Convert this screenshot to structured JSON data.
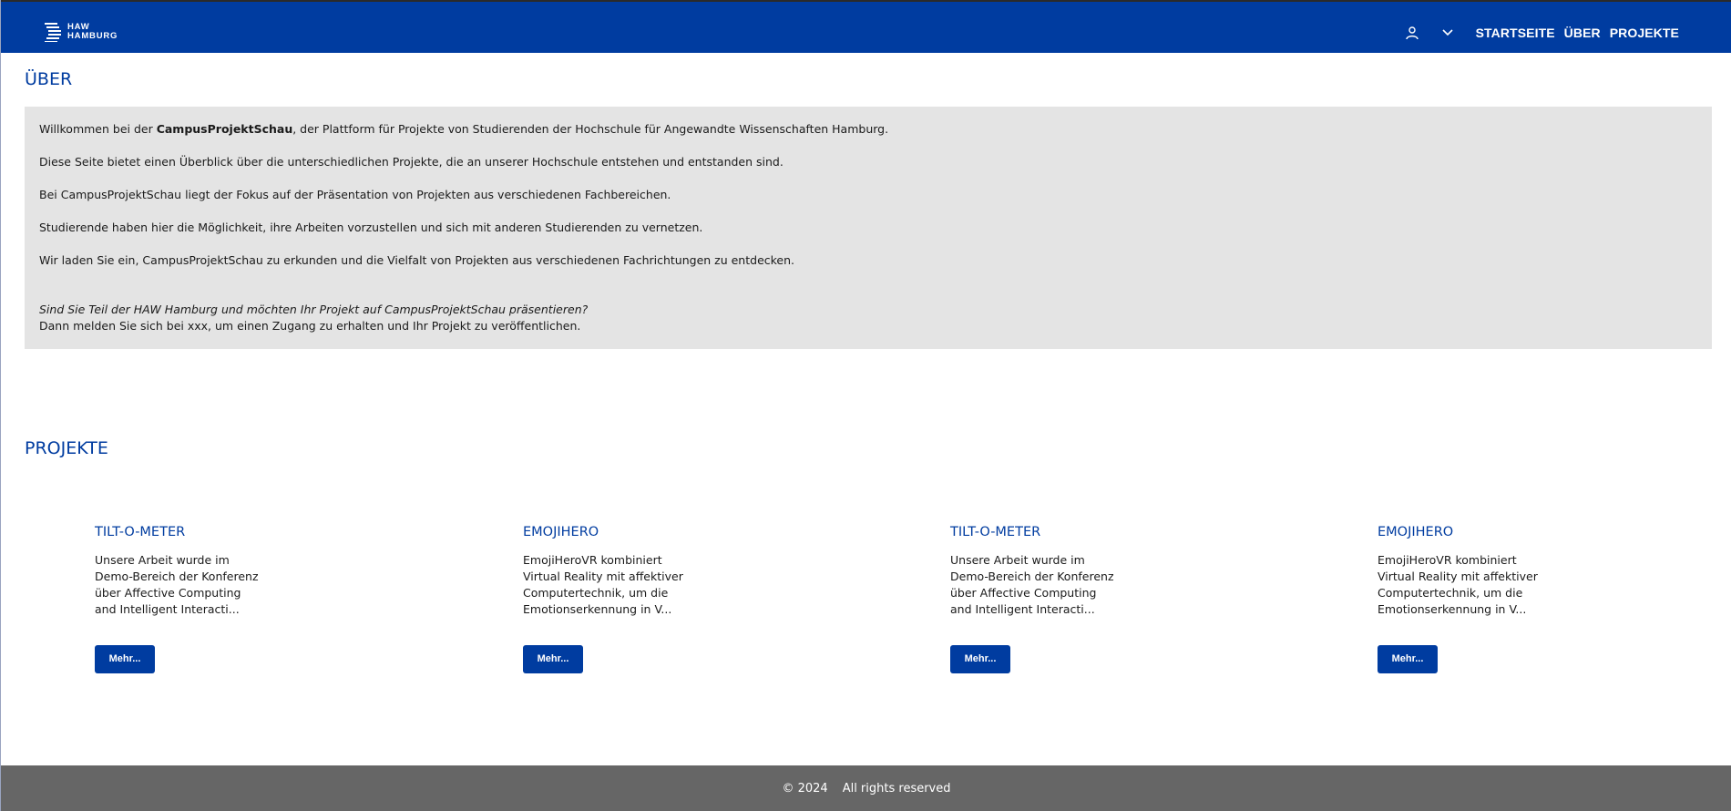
{
  "header": {
    "logo": {
      "line1": "HAW",
      "line2": "HAMBURG"
    },
    "icons": {
      "user": "user-icon",
      "menu": "chevron-down-icon"
    },
    "nav": [
      {
        "label": "STARTSEITE"
      },
      {
        "label": "ÜBER"
      },
      {
        "label": "PROJEKTE"
      }
    ],
    "colors": {
      "brand": "#003ca0",
      "footer": "#666666",
      "panel": "#e4e4e4"
    }
  },
  "about": {
    "title": "ÜBER",
    "intro_before": "Willkommen bei der ",
    "intro_strong": "CampusProjektSchau",
    "intro_after": ", der Plattform für Projekte von Studierenden der Hochschule für Angewandte Wissenschaften Hamburg.",
    "p2": "Diese Seite bietet einen Überblick über die unterschiedlichen Projekte, die an unserer Hochschule entstehen und entstanden sind.",
    "p3": "Bei CampusProjektSchau liegt der Fokus auf der Präsentation von Projekten aus verschiedenen Fachbereichen.",
    "p4": "Studierende haben hier die Möglichkeit, ihre Arbeiten vorzustellen und sich mit anderen Studierenden zu vernetzen.",
    "p5": "Wir laden Sie ein, CampusProjektSchau zu erkunden und die Vielfalt von Projekten aus verschiedenen Fachrichtungen zu entdecken.",
    "cta_question": "Sind Sie Teil der HAW Hamburg und möchten Ihr Projekt auf CampusProjektSchau präsentieren?",
    "cta_text": "Dann melden Sie sich bei xxx, um einen Zugang zu erhalten und Ihr Projekt zu veröffentlichen."
  },
  "projects": {
    "title": "PROJEKTE",
    "items": [
      {
        "title": "TILT-O-METER",
        "desc": "Unsere Arbeit wurde im Demo-Bereich der Konferenz über Affective Computing and Intelligent Interacti...",
        "button": "Mehr..."
      },
      {
        "title": "EMOJIHERO",
        "desc": "EmojiHeroVR kombiniert Virtual Reality mit affektiver Computertechnik, um die Emotionserkennung in V...",
        "button": "Mehr..."
      },
      {
        "title": "TILT-O-METER",
        "desc": "Unsere Arbeit wurde im Demo-Bereich der Konferenz über Affective Computing and Intelligent Interacti...",
        "button": "Mehr..."
      },
      {
        "title": "EMOJIHERO",
        "desc": "EmojiHeroVR kombiniert Virtual Reality mit affektiver Computertechnik, um die Emotionserkennung in V...",
        "button": "Mehr..."
      }
    ]
  },
  "footer": {
    "copyright": "© 2024",
    "rights": "All rights reserved"
  }
}
